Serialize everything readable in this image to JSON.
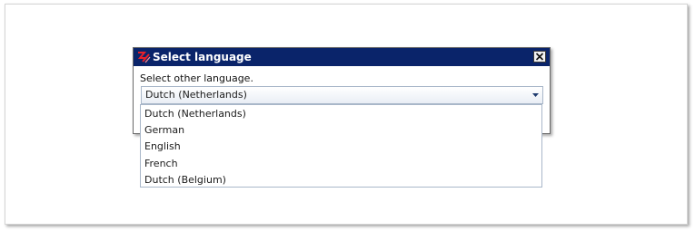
{
  "dialog": {
    "title": "Select language",
    "prompt": "Select other language.",
    "close_icon": "close-icon",
    "app_icon": "app-logo-icon"
  },
  "language_select": {
    "selected": "Dutch (Netherlands)",
    "options": [
      "Dutch (Netherlands)",
      "German",
      "English",
      "French",
      "Dutch (Belgium)"
    ]
  },
  "colors": {
    "titlebar": "#0a246a",
    "title_text": "#ffffff",
    "border": "#a9b7c9"
  }
}
